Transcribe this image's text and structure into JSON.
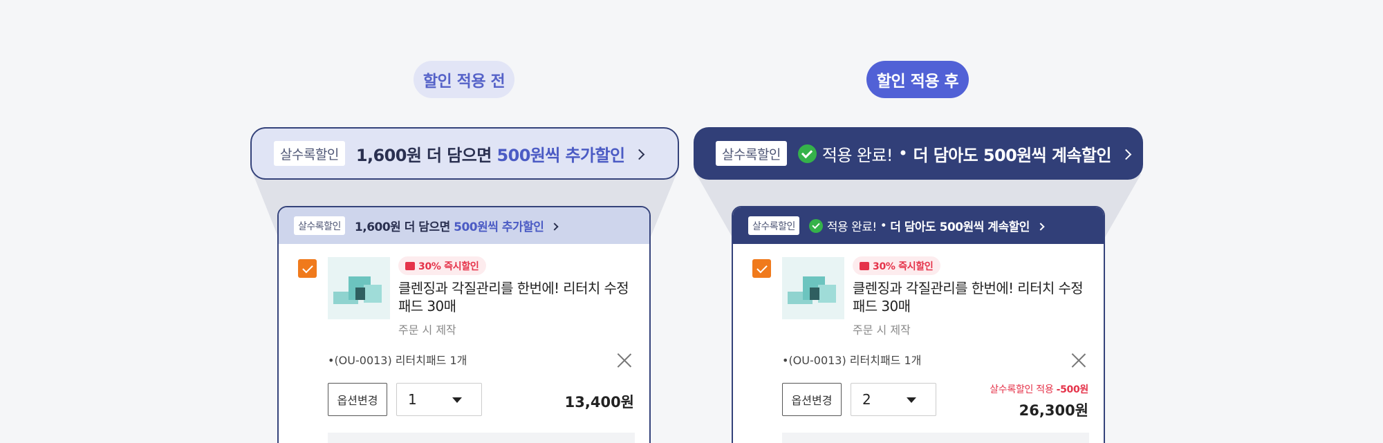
{
  "labels": {
    "before": "할인 적용 전",
    "after": "할인 적용 후"
  },
  "banner_before": {
    "tag": "살수록할인",
    "text_prefix": "1,600원 더 담으면 ",
    "text_highlight": "500원씩 추가할인"
  },
  "banner_after": {
    "tag": "살수록할인",
    "done": "적용 완료!",
    "dot": "•",
    "text": "더 담아도 500원씩 계속할인"
  },
  "card_before": {
    "badge": "30% 즉시할인",
    "product_name": "클렌징과 각질관리를 한번에! 리터치 수정패드 30매",
    "made_to_order": "주문 시 제작",
    "option": "•(OU-0013) 리터치패드 1개",
    "option_change": "옵션변경",
    "quantity": "1",
    "price": "13,400원"
  },
  "card_after": {
    "badge": "30% 즉시할인",
    "product_name": "클렌징과 각질관리를 한번에! 리터치 수정패드 30매",
    "made_to_order": "주문 시 제작",
    "option": "•(OU-0013) 리터치패드 1개",
    "option_change": "옵션변경",
    "quantity": "2",
    "discount_label": "살수록할인 적용 ",
    "discount_amount": "-500원",
    "price": "26,300원"
  },
  "colors": {
    "navy": "#313f78",
    "accent": "#4b5bc4",
    "check_green": "#35b24a",
    "checkbox_orange": "#f07a1c",
    "sale_red": "#e5334a"
  }
}
